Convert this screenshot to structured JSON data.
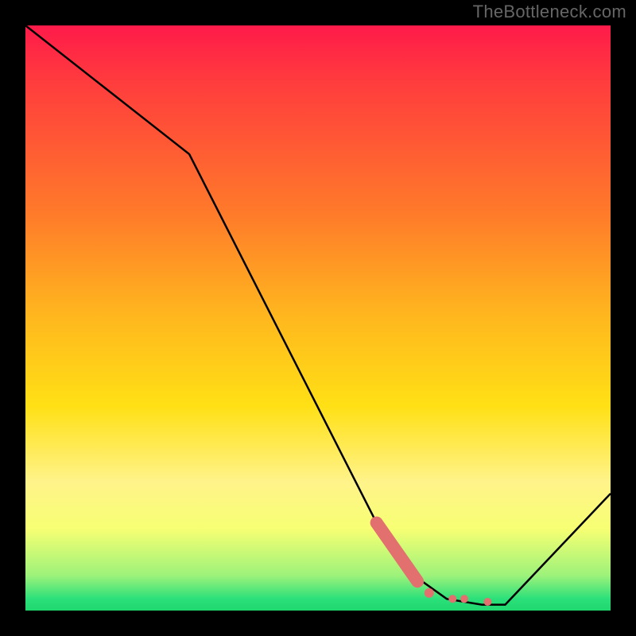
{
  "watermark": "TheBottleneck.com",
  "chart_data": {
    "type": "line",
    "title": "",
    "xlabel": "",
    "ylabel": "",
    "xlim": [
      0,
      100
    ],
    "ylim": [
      0,
      100
    ],
    "grid": false,
    "series": [
      {
        "name": "bottleneck-curve",
        "x": [
          0,
          28,
          60,
          65,
          72,
          78,
          82,
          100
        ],
        "values": [
          100,
          78,
          15,
          7,
          2,
          1,
          1,
          20
        ]
      }
    ],
    "markers": {
      "name": "highlight-segment",
      "color": "#e2706f",
      "bar": {
        "x_start": 60,
        "x_end": 67,
        "y_start": 15,
        "y_end": 5
      },
      "dots": [
        {
          "x": 69,
          "y": 3
        },
        {
          "x": 73,
          "y": 2
        },
        {
          "x": 75,
          "y": 2
        },
        {
          "x": 79,
          "y": 1.5
        }
      ]
    }
  }
}
